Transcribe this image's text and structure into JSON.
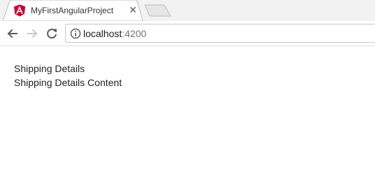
{
  "browser": {
    "tab": {
      "title": "MyFirstAngularProject",
      "close_glyph": "✕",
      "favicon": "angular-logo-icon"
    },
    "toolbar": {
      "back_icon": "arrow-left-icon",
      "forward_icon": "arrow-right-icon",
      "reload_icon": "reload-icon",
      "info_icon": "info-circle-icon"
    },
    "address": {
      "host": "localhost",
      "port": ":4200"
    }
  },
  "page": {
    "heading": "Shipping Details",
    "content": "Shipping Details Content"
  },
  "colors": {
    "tabstrip_bg": "#f2f2f2",
    "angular_red": "#dd0031",
    "angular_dark_red": "#c3002f",
    "port_gray": "#737373"
  }
}
